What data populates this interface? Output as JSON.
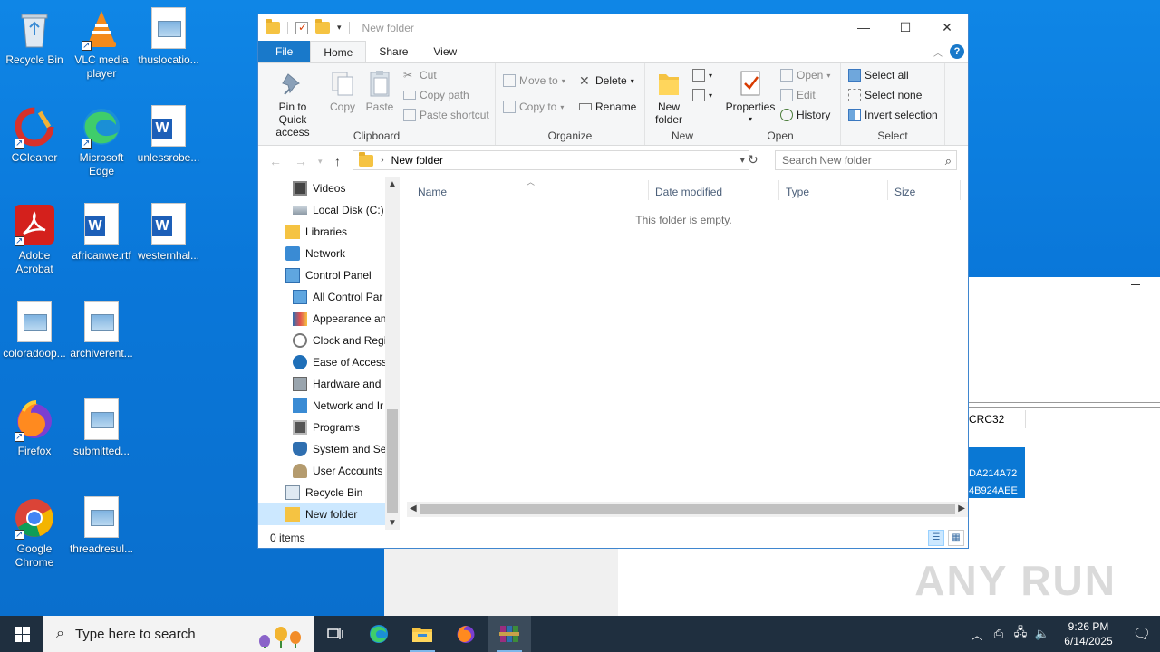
{
  "desktop": {
    "icons": [
      {
        "label": "Recycle Bin"
      },
      {
        "label": "VLC media player"
      },
      {
        "label": "thuslocatio..."
      },
      {
        "label": "CCleaner"
      },
      {
        "label": "Microsoft Edge"
      },
      {
        "label": "unlessrobe..."
      },
      {
        "label": "Adobe Acrobat"
      },
      {
        "label": "africanwe.rtf"
      },
      {
        "label": "westernhal..."
      },
      {
        "label": "coloradoop..."
      },
      {
        "label": "archiverent..."
      },
      {
        "label": "Firefox"
      },
      {
        "label": "submitted..."
      },
      {
        "label": "Google Chrome"
      },
      {
        "label": "threadresul..."
      }
    ]
  },
  "background_window": {
    "column_header": "CRC32",
    "selected_values": [
      "DA214A72",
      "4B924AEE"
    ],
    "watermark": "ANY RUN"
  },
  "explorer": {
    "title": "New folder",
    "window_controls": {
      "minimize": "—",
      "maximize": "☐",
      "close": "✕"
    },
    "tabs": [
      {
        "label": "File"
      },
      {
        "label": "Home"
      },
      {
        "label": "Share"
      },
      {
        "label": "View"
      }
    ],
    "help_label": "?",
    "ribbon": {
      "clipboard": {
        "label": "Clipboard",
        "pin": "Pin to Quick access",
        "pin_line1": "Pin to Quick",
        "pin_line2": "access",
        "copy": "Copy",
        "paste": "Paste",
        "cut": "Cut",
        "copy_path": "Copy path",
        "paste_shortcut": "Paste shortcut"
      },
      "organize": {
        "label": "Organize",
        "move_to": "Move to",
        "copy_to": "Copy to",
        "delete": "Delete",
        "rename": "Rename"
      },
      "new": {
        "label": "New",
        "new_folder_line1": "New",
        "new_folder_line2": "folder"
      },
      "open": {
        "label": "Open",
        "properties": "Properties",
        "open": "Open",
        "edit": "Edit",
        "history": "History"
      },
      "select": {
        "label": "Select",
        "select_all": "Select all",
        "select_none": "Select none",
        "invert_selection": "Invert selection"
      }
    },
    "address": {
      "path": "New folder",
      "search_placeholder": "Search New folder"
    },
    "nav_pane": [
      {
        "label": "Videos",
        "indent": 2
      },
      {
        "label": "Local Disk (C:)",
        "indent": 2
      },
      {
        "label": "Libraries",
        "indent": 1
      },
      {
        "label": "Network",
        "indent": 1
      },
      {
        "label": "Control Panel",
        "indent": 1
      },
      {
        "label": "All Control Par",
        "indent": 2
      },
      {
        "label": "Appearance an",
        "indent": 2
      },
      {
        "label": "Clock and Regi",
        "indent": 2
      },
      {
        "label": "Ease of Access",
        "indent": 2
      },
      {
        "label": "Hardware and ",
        "indent": 2
      },
      {
        "label": "Network and Ir",
        "indent": 2
      },
      {
        "label": "Programs",
        "indent": 2
      },
      {
        "label": "System and Se",
        "indent": 2
      },
      {
        "label": "User Accounts",
        "indent": 2
      },
      {
        "label": "Recycle Bin",
        "indent": 1
      },
      {
        "label": "New folder",
        "indent": 1,
        "selected": true
      }
    ],
    "columns": [
      {
        "label": "Name"
      },
      {
        "label": "Date modified"
      },
      {
        "label": "Type"
      },
      {
        "label": "Size"
      }
    ],
    "empty_message": "This folder is empty.",
    "status": "0 items"
  },
  "taskbar": {
    "search_placeholder": "Type here to search",
    "clock_time": "9:26 PM",
    "clock_date": "6/14/2025"
  },
  "colors": {
    "accent": "#1979ca",
    "desktop": "#0a77d9",
    "taskbar": "#1f2f3f",
    "selection": "#cce8ff"
  }
}
